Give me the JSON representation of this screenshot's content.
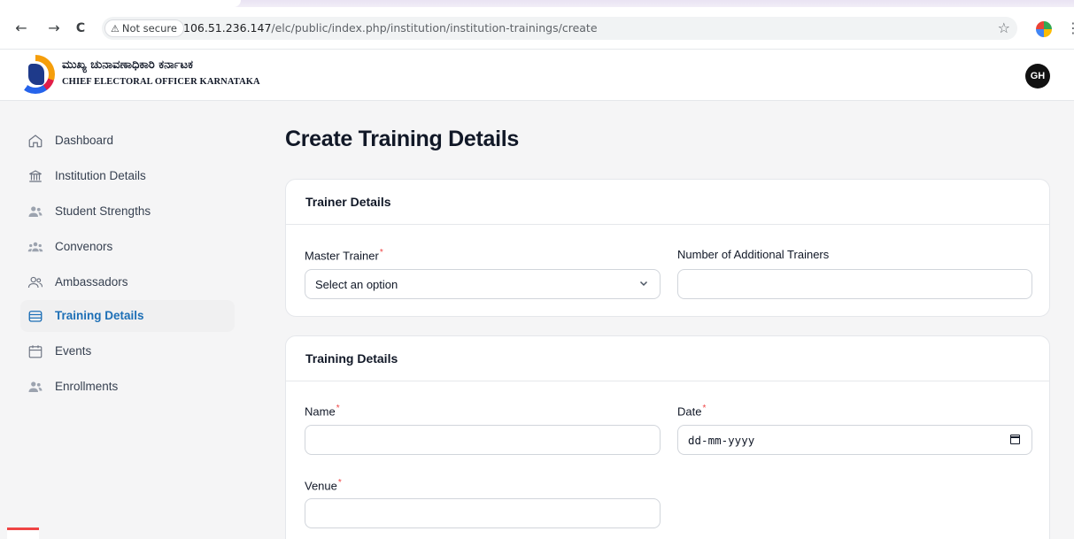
{
  "browser": {
    "back_icon": "←",
    "forward_icon": "→",
    "reload_icon": "C",
    "security_label": "Not secure",
    "warning_icon": "⚠",
    "url_host": "106.51.236.147",
    "url_path": "/elc/public/index.php/institution/institution-trainings/create",
    "star_icon": "☆",
    "menu_icon": "⋮"
  },
  "header": {
    "brand_kannada": "ಮುಖ್ಯ ಚುನಾವಣಾಧಿಕಾರಿ ಕರ್ನಾಟಕ",
    "brand_english": "CHIEF ELECTORAL OFFICER KARNATAKA",
    "avatar_initials": "GH"
  },
  "sidebar": {
    "items": [
      {
        "label": "Dashboard",
        "icon": "home-icon"
      },
      {
        "label": "Institution Details",
        "icon": "building-columns-icon"
      },
      {
        "label": "Student Strengths",
        "icon": "users-icon"
      },
      {
        "label": "Convenors",
        "icon": "user-group-icon"
      },
      {
        "label": "Ambassadors",
        "icon": "users-outline-icon"
      },
      {
        "label": "Training Details",
        "icon": "archive-box-icon",
        "active": true
      },
      {
        "label": "Events",
        "icon": "calendar-icon"
      },
      {
        "label": "Enrollments",
        "icon": "users-icon"
      }
    ],
    "active_color": "#1d6fb6"
  },
  "main": {
    "title": "Create Training Details",
    "trainer_section": {
      "heading": "Trainer Details",
      "master_trainer_label": "Master Trainer",
      "master_trainer_value": "Select an option",
      "additional_trainers_label": "Number of Additional Trainers",
      "additional_trainers_value": ""
    },
    "training_section": {
      "heading": "Training Details",
      "name_label": "Name",
      "name_value": "",
      "date_label": "Date",
      "date_placeholder": "dd-mm-yyyy",
      "venue_label": "Venue",
      "venue_value": ""
    },
    "required_marker": "*",
    "required_color": "#ef4444"
  }
}
